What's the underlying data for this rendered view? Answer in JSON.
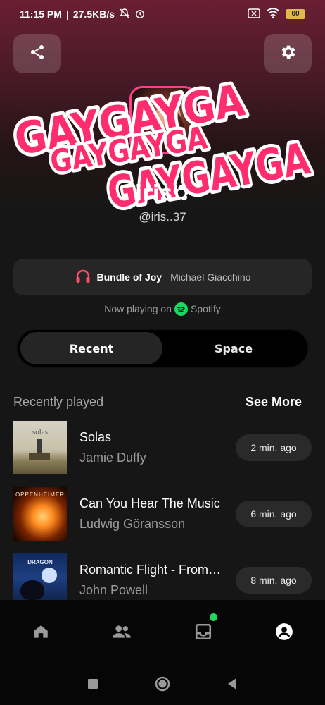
{
  "status_bar": {
    "time": "11:15 PM",
    "speed": "27.5KB/s",
    "battery": "60"
  },
  "profile": {
    "display_name": "iris✿",
    "handle": "@iris..37",
    "sticker_text": [
      "GAYGAYGA",
      "GAYGAYGA",
      "GAYGAYGA"
    ],
    "sticker_color": "#ff2d6f"
  },
  "now_playing": {
    "title": "Bundle of Joy",
    "artist": "Michael Giacchino",
    "source_prefix": "Now playing on",
    "source_name": "Spotify",
    "accent": "#ff4d6d"
  },
  "tabs": [
    {
      "label": "Recent",
      "active": true
    },
    {
      "label": "Space",
      "active": false
    }
  ],
  "recent": {
    "title": "Recently played",
    "see_more": "See More",
    "items": [
      {
        "song": "Solas",
        "artist": "Jamie Duffy",
        "time": "2 min. ago",
        "cover_text": "solas"
      },
      {
        "song": "Can You Hear The Music",
        "artist": "Ludwig Göransson",
        "time": "6 min. ago",
        "cover_text": "OPPENHEIMER"
      },
      {
        "song": "Romantic Flight - From How to Train Your Dragon",
        "artist": "John Powell",
        "time": "8 min. ago",
        "cover_text": "DRAGON"
      }
    ]
  },
  "bottom_nav": [
    {
      "icon": "home-icon"
    },
    {
      "icon": "friends-icon"
    },
    {
      "icon": "inbox-icon",
      "has_notification": true
    },
    {
      "icon": "profile-icon",
      "active": true
    }
  ],
  "colors": {
    "spotify": "#1ed760",
    "pink": "#ff3f87"
  }
}
